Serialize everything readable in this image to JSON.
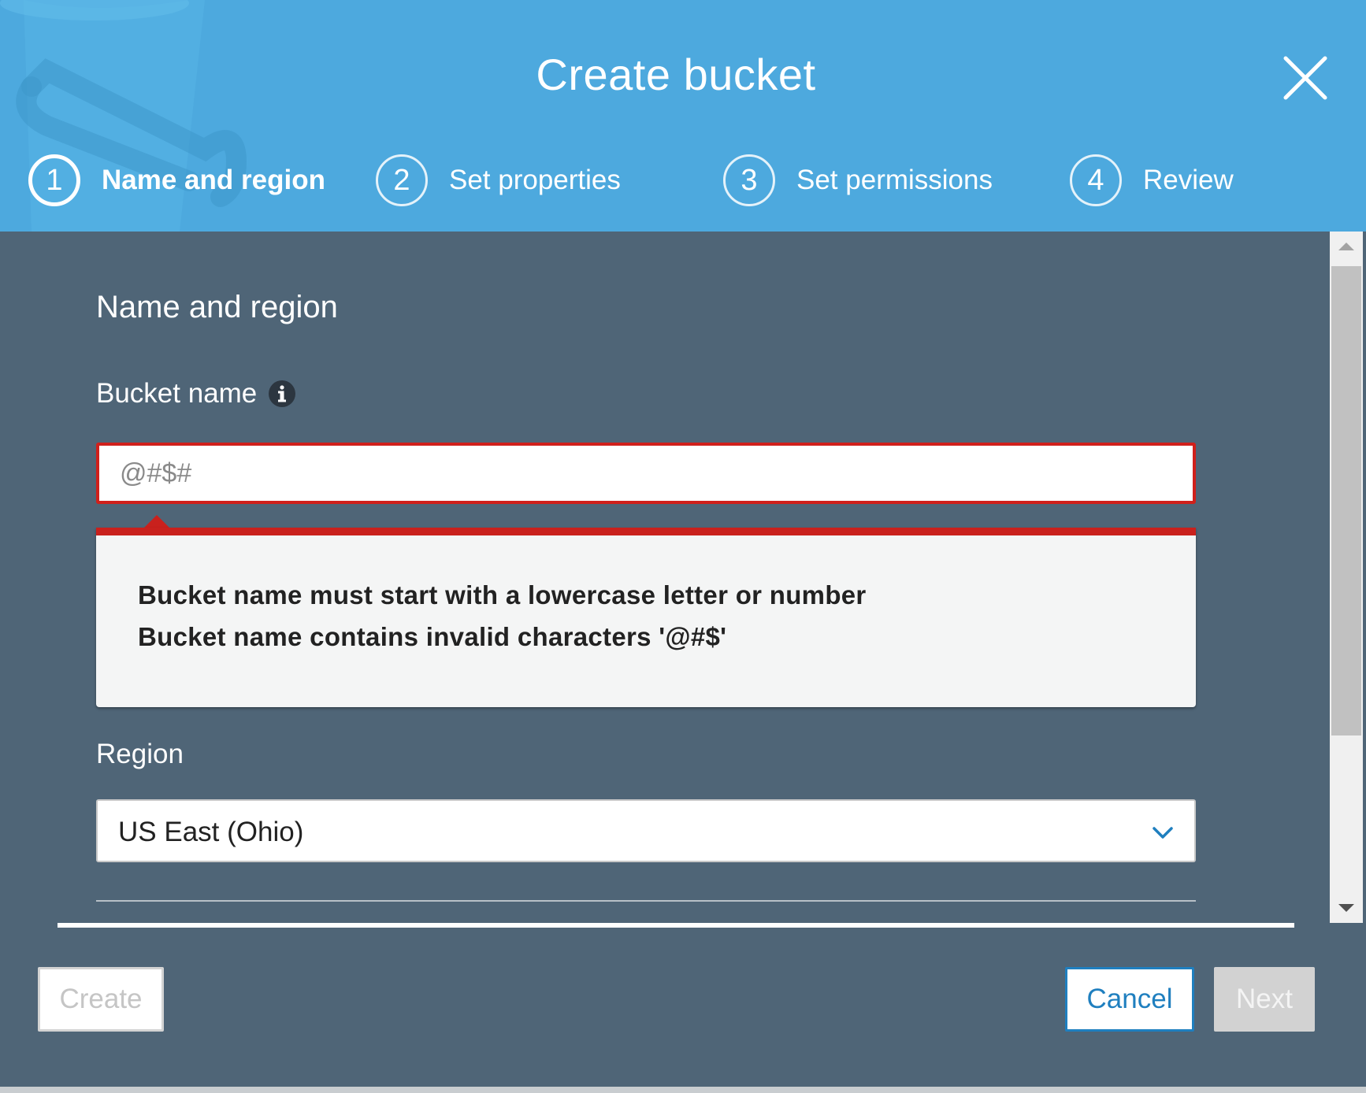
{
  "dialog": {
    "title": "Create bucket"
  },
  "steps": [
    {
      "number": "1",
      "label": "Name and region",
      "active": true
    },
    {
      "number": "2",
      "label": "Set properties",
      "active": false
    },
    {
      "number": "3",
      "label": "Set permissions",
      "active": false
    },
    {
      "number": "4",
      "label": "Review",
      "active": false
    }
  ],
  "form": {
    "section_title": "Name and region",
    "bucket_name_label": "Bucket name",
    "bucket_name_value": "@#$#",
    "errors": [
      "Bucket name must start with a lowercase letter or number",
      "Bucket name contains invalid characters '@#$'"
    ],
    "region_label": "Region",
    "region_value": "US East (Ohio)"
  },
  "buttons": {
    "create": "Create",
    "cancel": "Cancel",
    "next": "Next"
  },
  "colors": {
    "header_bg": "#4da9de",
    "body_bg": "#4f6577",
    "error_red": "#c9211d",
    "link_blue": "#1f7fbf"
  },
  "icons": {
    "close": "close-icon",
    "info": "info-icon",
    "dropdown": "chevron-down-icon"
  }
}
